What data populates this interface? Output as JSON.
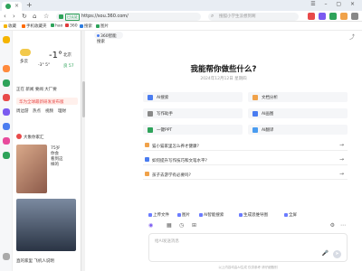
{
  "browser": {
    "tab_close": "×",
    "new_tab": "+",
    "window_controls": "☰ – ▢ ×",
    "security_badge": "已认证",
    "url": "https://sou.360.com/",
    "search_placeholder": "搜狐小学生没想到啊",
    "nav_icons": [
      "back-icon",
      "forward-icon",
      "refresh-icon",
      "home-icon",
      "star-icon"
    ]
  },
  "bookmarks": [
    {
      "label": "收藏",
      "color": "#f5b400"
    },
    {
      "label": "手机收藏夹",
      "color": "#ff6a00"
    },
    {
      "label": "hao",
      "color": "#2ea35a"
    },
    {
      "label": "360",
      "color": "#e03b3b"
    },
    {
      "label": "搜索",
      "color": "#2e7de0"
    },
    {
      "label": "图片",
      "color": "#2ea35a"
    }
  ],
  "panel": {
    "weather_label": "多云",
    "temperature": "-1°",
    "temp_range": "-3°  5°",
    "city": "北京",
    "aqi_label": "良 57",
    "nav_links": [
      "正在  新闻  要闻  大厂要"
    ],
    "hot_headline": "华为全球最新研发发布版",
    "tags": [
      "周边游",
      "热点",
      "视频",
      "理财"
    ],
    "author": "大象你家汇",
    "story1": "75岁\n你会\n看到这\n样的",
    "story2_caption": "直的家里  飞机人说明"
  },
  "main": {
    "chip_label": "360智能搜索",
    "headline": "我能帮你做些什么?",
    "subline": "2024年12月12日  星期四",
    "quick_actions": [
      {
        "label": "AI搜索",
        "color": "#4a7cf0"
      },
      {
        "label": "文档分析",
        "color": "#f0a24a"
      },
      {
        "label": "写作助手",
        "color": "#888888"
      },
      {
        "label": "AI画图",
        "color": "#4a7cf0"
      },
      {
        "label": "一键PPT",
        "color": "#2ea35a"
      },
      {
        "label": "AI翻译",
        "color": "#4a9cf0"
      }
    ],
    "suggestions": [
      {
        "text": "猫小猫家里怎么养才健康?",
        "color": "#f0a24a"
      },
      {
        "text": "如何提升写作技巧和文笔水平?",
        "color": "#4a7cf0"
      },
      {
        "text": "孩子去游学有必要吗?",
        "color": "#f0a24a"
      }
    ],
    "tools": [
      "上传文件",
      "图片",
      "AI智能搜索",
      "生成思维导图",
      "全屏"
    ],
    "input_placeholder": "给AI发送消息",
    "send_symbol": "➤",
    "mic_symbol": "🎤",
    "footer": "以上内容均由AI生成  仅供参考  请仔细甄别"
  }
}
